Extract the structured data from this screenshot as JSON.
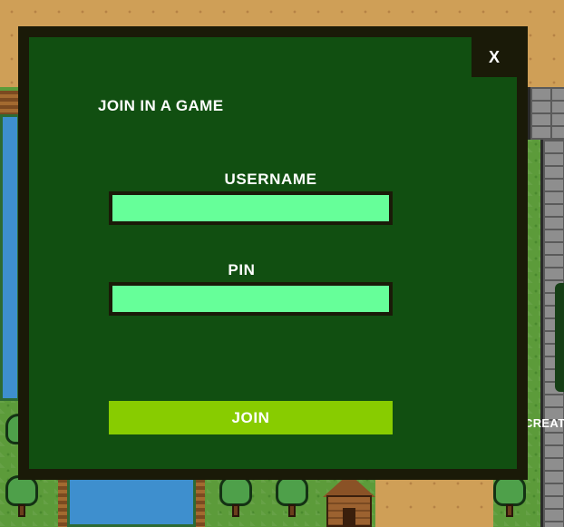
{
  "background": {
    "side_label": "CREAT"
  },
  "modal": {
    "title": "JOIN IN A GAME",
    "close_label": "X",
    "username": {
      "label": "USERNAME",
      "value": "",
      "placeholder": ""
    },
    "pin": {
      "label": "PIN",
      "value": "",
      "placeholder": ""
    },
    "join_label": "JOIN"
  },
  "colors": {
    "modal_border": "#1a1a08",
    "modal_background": "#114f11",
    "input_background": "#66ff99",
    "join_button": "#88cc00",
    "text": "#ffffff"
  }
}
